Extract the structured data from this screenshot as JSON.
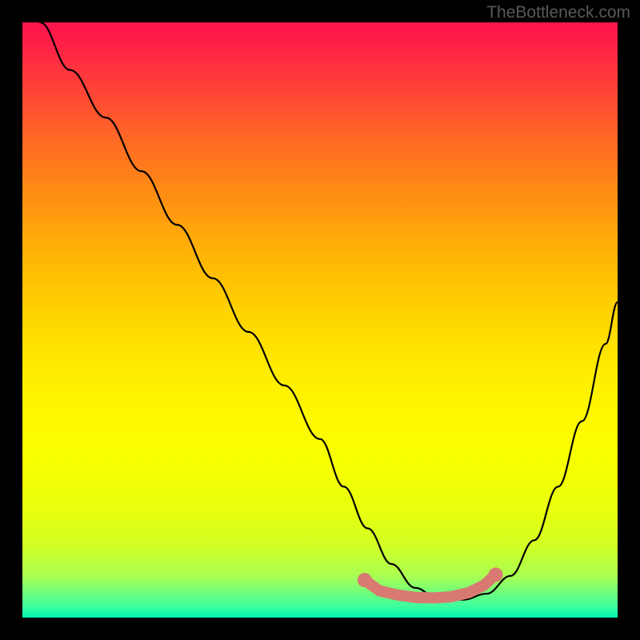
{
  "watermark": "TheBottleneck.com",
  "chart_data": {
    "type": "line",
    "title": "",
    "xlabel": "",
    "ylabel": "",
    "xlim": [
      0,
      100
    ],
    "ylim": [
      0,
      100
    ],
    "series": [
      {
        "name": "bottleneck-curve",
        "x": [
          3,
          8,
          14,
          20,
          26,
          32,
          38,
          44,
          50,
          54,
          58,
          62,
          66,
          70,
          74,
          78,
          82,
          86,
          90,
          94,
          98,
          100
        ],
        "values": [
          100,
          92,
          84,
          75,
          66,
          57,
          48,
          39,
          30,
          22,
          15,
          9,
          5,
          3,
          3,
          4,
          7,
          13,
          22,
          33,
          46,
          53
        ]
      }
    ],
    "highlight": {
      "name": "optimal-range-marker",
      "color": "#d87a72",
      "points": [
        {
          "x": 57.5,
          "y": 6.3
        },
        {
          "x": 60,
          "y": 4.5
        },
        {
          "x": 63,
          "y": 3.8
        },
        {
          "x": 66,
          "y": 3.4
        },
        {
          "x": 69,
          "y": 3.3
        },
        {
          "x": 72,
          "y": 3.5
        },
        {
          "x": 75,
          "y": 4.2
        },
        {
          "x": 77.5,
          "y": 5.4
        },
        {
          "x": 79.5,
          "y": 7.2
        }
      ]
    },
    "gradient": {
      "top_color": "#ff134e",
      "mid_color": "#ffe600",
      "bottom_color": "#00f3b0"
    }
  }
}
